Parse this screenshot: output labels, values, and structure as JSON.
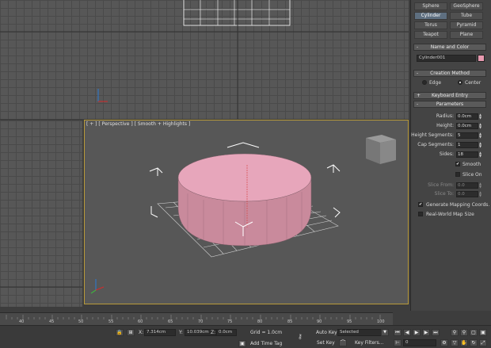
{
  "viewports": {
    "perspective_label": "[ + ] [ Perspective ] [ Smooth + Highlights ]"
  },
  "object_types": [
    "Sphere",
    "GeoSphere",
    "Cylinder",
    "Tube",
    "Torus",
    "Pyramid",
    "Teapot",
    "Plane"
  ],
  "active_object_type": "Cylinder",
  "name_and_color": {
    "header": "Name and Color",
    "name_value": "Cylinder001",
    "swatch_color": "#e89ab0"
  },
  "creation_method": {
    "header": "Creation Method",
    "edge_label": "Edge",
    "center_label": "Center",
    "selected": "Center"
  },
  "keyboard_entry": {
    "header": "Keyboard Entry"
  },
  "parameters": {
    "header": "Parameters",
    "radius_label": "Radius:",
    "radius_value": "0.0cm",
    "height_label": "Height:",
    "height_value": "0.0cm",
    "height_segments_label": "Height Segments:",
    "height_segments_value": "5",
    "cap_segments_label": "Cap Segments:",
    "cap_segments_value": "1",
    "sides_label": "Sides:",
    "sides_value": "18",
    "smooth_label": "Smooth",
    "smooth_checked": true,
    "slice_on_label": "Slice On",
    "slice_on_checked": false,
    "slice_from_label": "Slice From:",
    "slice_from_value": "0.0",
    "slice_to_label": "Slice To:",
    "slice_to_value": "0.0",
    "gen_mapping_label": "Generate Mapping Coords.",
    "gen_mapping_checked": true,
    "real_world_label": "Real-World Map Size",
    "real_world_checked": false
  },
  "timeline": {
    "ticks": [
      "40",
      "45",
      "50",
      "55",
      "60",
      "65",
      "70",
      "75",
      "80",
      "85",
      "90",
      "95",
      "100"
    ]
  },
  "status_bar": {
    "x_label": "X:",
    "x_value": "7.314cm",
    "y_label": "Y:",
    "y_value": "10.039cm",
    "z_label": "Z:",
    "z_value": "0.0cm",
    "grid_text": "Grid = 1.0cm",
    "add_time_tag": "Add Time Tag",
    "auto_key_label": "Auto Key",
    "auto_key_value": "Selected",
    "set_key_label": "Set Key",
    "key_filters_label": "Key Filters...",
    "frame_value": "0"
  },
  "colors": {
    "cylinder_top": "#e7a6bb",
    "cylinder_side": "#c98a9c",
    "viewport_border": "#b89a3a",
    "viewport_bg": "#575757"
  }
}
